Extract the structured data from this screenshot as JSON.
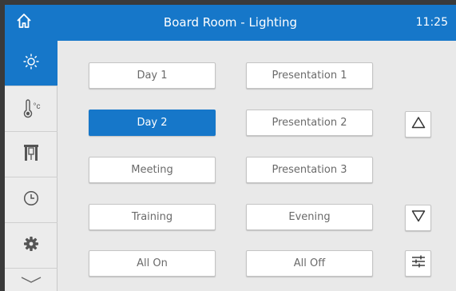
{
  "header": {
    "title": "Board Room - Lighting",
    "time": "11:25",
    "home_icon": "home-icon"
  },
  "sidebar": {
    "items": [
      {
        "name": "lighting",
        "icon": "sun-icon",
        "active": true
      },
      {
        "name": "climate",
        "icon": "thermometer-icon",
        "label": "°c",
        "active": false
      },
      {
        "name": "shades",
        "icon": "shades-icon",
        "active": false
      },
      {
        "name": "schedule",
        "icon": "clock-icon",
        "active": false
      },
      {
        "name": "settings",
        "icon": "gear-icon",
        "active": false
      },
      {
        "name": "more",
        "icon": "chevron-down-icon",
        "active": false
      }
    ]
  },
  "scenes": {
    "left": [
      "Day 1",
      "Day 2",
      "Meeting",
      "Training",
      "All On"
    ],
    "right": [
      "Presentation 1",
      "Presentation 2",
      "Presentation 3",
      "Evening",
      "All Off"
    ],
    "selected": "Day 2"
  },
  "controls": {
    "up_icon": "triangle-up-icon",
    "down_icon": "triangle-down-icon",
    "adjust_icon": "sliders-icon"
  },
  "colors": {
    "accent": "#1677c9",
    "background": "#e9e9e9",
    "button": "#ffffff",
    "button_text": "#6a6a6a"
  }
}
